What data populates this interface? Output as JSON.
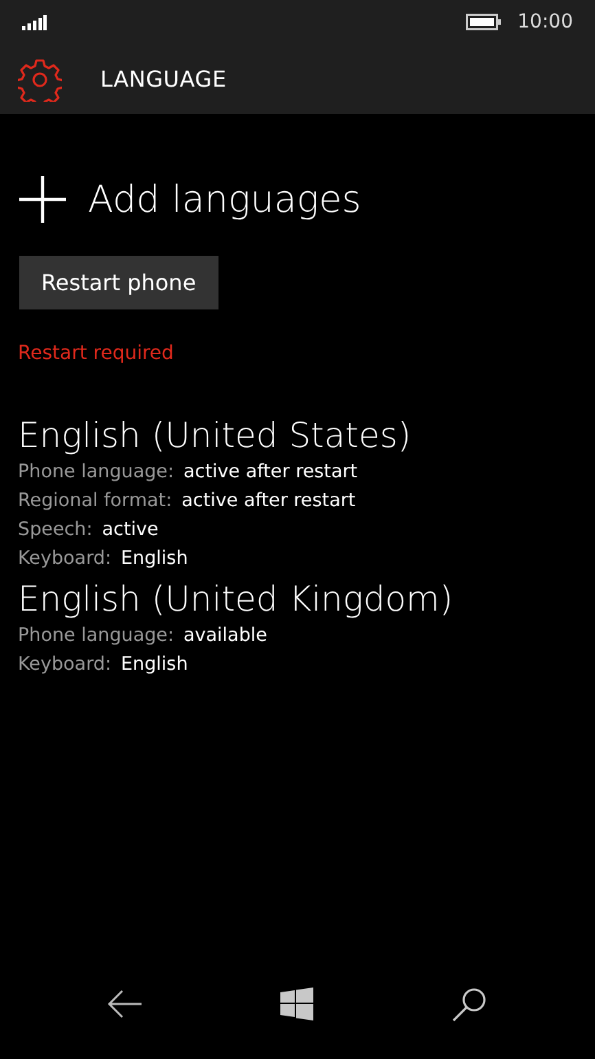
{
  "status_bar": {
    "time": "10:00"
  },
  "header": {
    "title": "LANGUAGE"
  },
  "add_languages": {
    "label": "Add languages"
  },
  "restart_button": {
    "label": "Restart phone"
  },
  "restart_notice": "Restart required",
  "languages": [
    {
      "name": "English (United States)",
      "details": [
        {
          "label": "Phone language:",
          "value": "active after restart"
        },
        {
          "label": "Regional format:",
          "value": "active after restart"
        },
        {
          "label": "Speech:",
          "value": "active"
        },
        {
          "label": "Keyboard:",
          "value": "English"
        }
      ]
    },
    {
      "name": "English (United Kingdom)",
      "details": [
        {
          "label": "Phone language:",
          "value": "available"
        },
        {
          "label": "Keyboard:",
          "value": "English"
        }
      ]
    }
  ]
}
